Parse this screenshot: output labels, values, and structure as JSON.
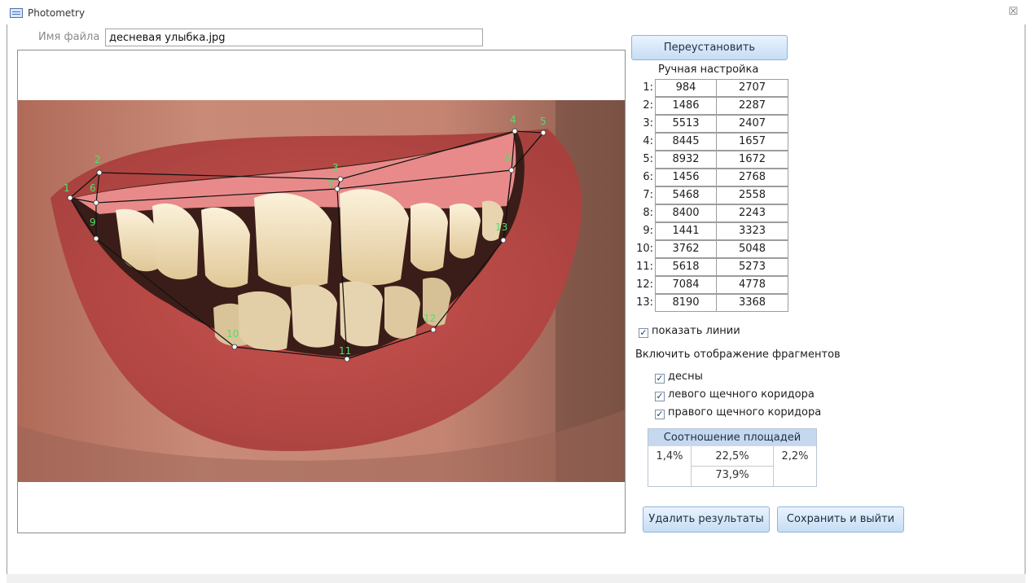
{
  "window": {
    "title": "Photometry",
    "close_glyph": "☒"
  },
  "file": {
    "label": "Имя файла",
    "value": "десневая улыбка.jpg"
  },
  "buttons": {
    "reset": "Переустановить",
    "delete": "Удалить результаты",
    "save": "Сохранить и выйти"
  },
  "manual": {
    "title": "Ручная настройка",
    "points": [
      {
        "idx": "1:",
        "x": "984",
        "y": "2707"
      },
      {
        "idx": "2:",
        "x": "1486",
        "y": "2287"
      },
      {
        "idx": "3:",
        "x": "5513",
        "y": "2407"
      },
      {
        "idx": "4:",
        "x": "8445",
        "y": "1657"
      },
      {
        "idx": "5:",
        "x": "8932",
        "y": "1672"
      },
      {
        "idx": "6:",
        "x": "1456",
        "y": "2768"
      },
      {
        "idx": "7:",
        "x": "5468",
        "y": "2558"
      },
      {
        "idx": "8:",
        "x": "8400",
        "y": "2243"
      },
      {
        "idx": "9:",
        "x": "1441",
        "y": "3323"
      },
      {
        "idx": "10:",
        "x": "3762",
        "y": "5048"
      },
      {
        "idx": "11:",
        "x": "5618",
        "y": "5273"
      },
      {
        "idx": "12:",
        "x": "7084",
        "y": "4778"
      },
      {
        "idx": "13:",
        "x": "8190",
        "y": "3368"
      }
    ]
  },
  "options": {
    "show_lines": {
      "label": "показать линии",
      "checked": true
    },
    "fragments_title": "Включить отображение фрагментов",
    "gums": {
      "label": "десны",
      "checked": true
    },
    "left_corridor": {
      "label": "левого щечного коридора",
      "checked": true
    },
    "right_corridor": {
      "label": "правого щечного коридора",
      "checked": true
    }
  },
  "ratio": {
    "title": "Соотношение площадей",
    "left": "1,4%",
    "gums": "22,5%",
    "right": "2,2%",
    "teeth": "73,9%"
  },
  "markers": [
    "1",
    "2",
    "3",
    "4",
    "5",
    "6",
    "7",
    "8",
    "9",
    "10",
    "11",
    "12",
    "13"
  ],
  "colors": {
    "marker_label": "#4ee06a",
    "button_border": "#8fb4dc",
    "ratio_header": "#c5d8ee"
  }
}
